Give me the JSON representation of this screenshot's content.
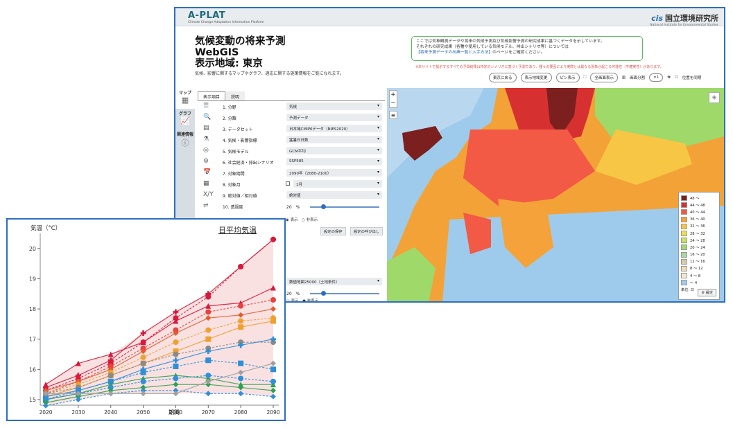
{
  "header": {
    "logo": "A-PLAT",
    "logo_sub": "Climate Change Adaptation Information Platform",
    "institute_jp": "国立環境研究所",
    "institute_en": "National Institute for Environmental Studies"
  },
  "title": {
    "line1": "気候変動の将来予測",
    "line2": "WebGIS",
    "line3": "表示地域: 東京",
    "desc": "気候、影響に関するマップやグラフ、適応に関する施策情報をご覧になれます。"
  },
  "note": {
    "line1": "ここでは気象観測データや将来の気候予測及び気候影響予測の研究成果に基づくデータを示しています。",
    "line2": "それぞれの研究成果（各種や使用している気候モデル、排出シナリオ等）については",
    "line3_link": "【将来予測データの出典一覧と入手方法】",
    "line3_tail": "のページをご確認ください。",
    "warning": "※本サイトで提示するすべての予測結果は特定のシナリオに基づく予測であり、種々の要因により実際とは異なる現象が起こる可能性（不確実性）があります。"
  },
  "toolbar": {
    "back": "東京に戻る",
    "change_region": "表示地域変更",
    "pin": "ピン表示",
    "fullscreen": "全画面表示",
    "split_label": "画面分割",
    "split_value": "×1",
    "sync_label": "位置を同期"
  },
  "sidebar": [
    {
      "label": "マップ",
      "icon": "map-icon"
    },
    {
      "label": "グラフ",
      "icon": "graph-icon"
    },
    {
      "label": "関連情報",
      "icon": "info-icon"
    }
  ],
  "tabs": [
    "表示項目",
    "説明"
  ],
  "rows": [
    {
      "label": "1. 分野",
      "value": "気候"
    },
    {
      "label": "2. 分類",
      "value": "予測データ"
    },
    {
      "label": "3. データセット",
      "value": "日本域CMIP6データ（NIES2020）"
    },
    {
      "label": "4. 気候・影響指標",
      "value": "猛暑日日数"
    },
    {
      "label": "5. 気候モデル",
      "value": "GCM平均"
    },
    {
      "label": "6. 社会経済・排出シナリオ",
      "value": "SSP585"
    },
    {
      "label": "7. 対象期間",
      "value": "2090年（2080-2100）"
    },
    {
      "label": "8. 対象月",
      "value": "1月"
    },
    {
      "label": "9. 絶対値／相対値",
      "value": "絶対値"
    },
    {
      "label": "10. 透過度",
      "value": "20"
    }
  ],
  "panel_misc": {
    "pct": "%",
    "show": "表示",
    "hide": "非表示",
    "save": "設定の保存",
    "load": "設定の呼び出し",
    "base_map": "数値地図25000（土地条件）",
    "pct2": "20"
  },
  "legend": {
    "items": [
      {
        "label": "48 ～",
        "color": "#7b1f1f"
      },
      {
        "label": "44 ～ 48",
        "color": "#d73030"
      },
      {
        "label": "40 ～ 44",
        "color": "#f25a45"
      },
      {
        "label": "36 ～ 40",
        "color": "#f5a23a"
      },
      {
        "label": "32 ～ 36",
        "color": "#f7c644"
      },
      {
        "label": "28 ～ 32",
        "color": "#ede04a"
      },
      {
        "label": "24 ～ 28",
        "color": "#c6e35a"
      },
      {
        "label": "20 ～ 24",
        "color": "#9ed96a"
      },
      {
        "label": "16 ～ 20",
        "color": "#a8d9a0"
      },
      {
        "label": "12 ～ 16",
        "color": "#d9cba6"
      },
      {
        "label": "8 ～ 12",
        "color": "#ecdcb8"
      },
      {
        "label": "4 ～ 8",
        "color": "#f3ead3"
      },
      {
        "label": "～ 4",
        "color": "#9ecbeb"
      }
    ],
    "unit": "単位: 日",
    "settings": "設定"
  },
  "chart_data": {
    "type": "line",
    "title": "日平均気温",
    "ylabel": "気温（°C）",
    "xlabel": "期間",
    "ylim": [
      15,
      20.5
    ],
    "yticks": [
      15,
      16,
      17,
      18,
      19,
      20
    ],
    "x": [
      2020,
      2030,
      2040,
      2050,
      2060,
      2070,
      2080,
      2090
    ],
    "series": [
      {
        "color": "#d7193b",
        "marker": "plus",
        "values": [
          15.4,
          15.8,
          16.3,
          17.2,
          17.9,
          18.5,
          19.4,
          20.3
        ]
      },
      {
        "color": "#d7193b",
        "marker": "circle",
        "values": [
          15.3,
          15.7,
          16.2,
          16.9,
          17.7,
          18.4,
          19.4,
          20.3
        ]
      },
      {
        "color": "#d7193b",
        "marker": "triangle",
        "values": [
          15.5,
          16.2,
          16.5,
          16.9,
          17.6,
          18.1,
          18.2,
          18.7
        ]
      },
      {
        "color": "#e8413f",
        "marker": "circle",
        "values": [
          15.2,
          15.6,
          16.1,
          16.7,
          17.3,
          17.9,
          18.1,
          18.3
        ]
      },
      {
        "color": "#e65a2a",
        "marker": "diamond",
        "values": [
          15.3,
          15.6,
          16.0,
          16.6,
          17.2,
          17.7,
          17.8,
          18.0
        ]
      },
      {
        "color": "#f0a030",
        "marker": "circle",
        "values": [
          15.2,
          15.5,
          15.9,
          16.4,
          16.9,
          17.3,
          17.6,
          17.7
        ]
      },
      {
        "color": "#f0a030",
        "marker": "square",
        "values": [
          15.1,
          15.4,
          15.8,
          16.2,
          16.6,
          17.0,
          17.4,
          17.6
        ]
      },
      {
        "color": "#8a8a8a",
        "marker": "circle",
        "values": [
          15.2,
          15.4,
          15.8,
          16.2,
          16.5,
          16.7,
          16.9,
          16.9
        ]
      },
      {
        "color": "#2f8fd8",
        "marker": "plus",
        "values": [
          15.1,
          15.3,
          15.6,
          16.0,
          16.3,
          16.6,
          16.8,
          17.0
        ]
      },
      {
        "color": "#2f8fd8",
        "marker": "square",
        "values": [
          15.0,
          15.3,
          15.6,
          15.9,
          16.1,
          16.3,
          16.2,
          16.0
        ]
      },
      {
        "color": "#2fa050",
        "marker": "triangle",
        "values": [
          15.0,
          15.2,
          15.5,
          15.7,
          15.8,
          15.7,
          15.5,
          15.5
        ]
      },
      {
        "color": "#2f8fd8",
        "marker": "circle",
        "values": [
          15.0,
          15.2,
          15.4,
          15.6,
          15.7,
          15.8,
          15.7,
          15.6
        ]
      },
      {
        "color": "#2fa050",
        "marker": "diamond",
        "values": [
          14.9,
          15.1,
          15.3,
          15.4,
          15.5,
          15.5,
          15.4,
          15.3
        ]
      },
      {
        "color": "#2f8fd8",
        "marker": "diamond",
        "values": [
          14.8,
          15.0,
          15.2,
          15.3,
          15.3,
          15.2,
          15.2,
          15.1
        ]
      },
      {
        "color": "#a0a0a0",
        "marker": "diamond",
        "values": [
          15.2,
          15.2,
          15.2,
          15.2,
          15.2,
          15.6,
          15.9,
          16.2
        ]
      }
    ],
    "band_top": [
      15.5,
      16.2,
      16.5,
      17.2,
      17.9,
      18.5,
      19.4,
      20.3
    ],
    "band_bottom": [
      14.8,
      15.0,
      15.2,
      15.2,
      15.2,
      15.2,
      15.2,
      15.1
    ]
  }
}
